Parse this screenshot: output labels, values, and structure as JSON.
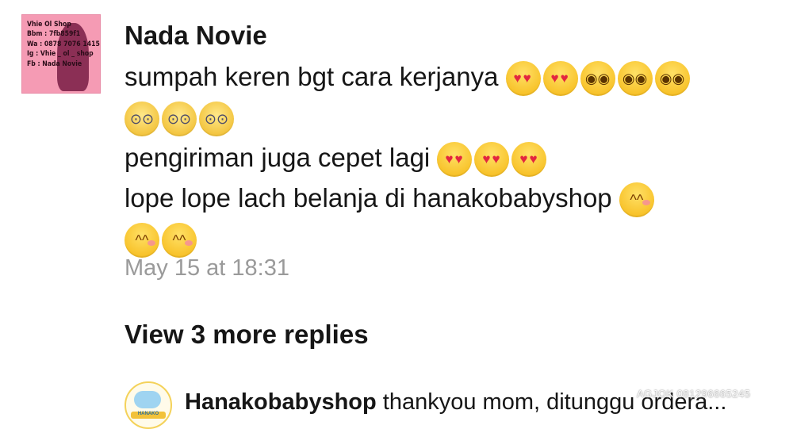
{
  "comment": {
    "avatar": {
      "lines": [
        "Vhie Ol Shop",
        "Bbm : 7fb859f1",
        "Wa : 0878 7076 1415",
        "Ig : Vhie _ ol _ shop",
        "Fb : Nada Novie"
      ]
    },
    "author": "Nada Novie",
    "lines": [
      {
        "text": "sumpah keren bgt cara kerjanya",
        "emojis": [
          "heart-eyes",
          "heart-eyes",
          "astonished",
          "astonished",
          "astonished"
        ]
      },
      {
        "text": "",
        "emojis": [
          "scream",
          "scream",
          "scream"
        ]
      },
      {
        "text": "pengiriman juga cepet lagi",
        "emojis": [
          "heart-eyes",
          "heart-eyes",
          "heart-eyes"
        ]
      },
      {
        "text": "lope lope lach belanja di hanakobabyshop",
        "emojis": [
          "kissing-smiling-eyes"
        ]
      },
      {
        "text": "",
        "emojis": [
          "kissing-smiling-eyes",
          "kissing-smiling-eyes"
        ]
      }
    ],
    "timestamp": "May 15 at 18:31"
  },
  "view_more_label": "View 3 more replies",
  "reply": {
    "avatar_text": "HANAKO",
    "author": "Hanakobabyshop",
    "text": "thankyou mom, ditunggu ordera..."
  },
  "watermark": "AGJOK 081296665245"
}
